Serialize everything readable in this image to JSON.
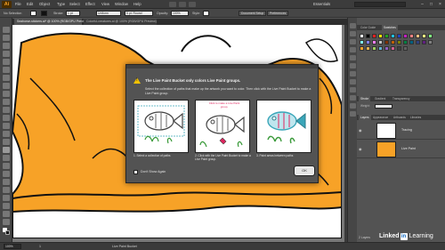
{
  "app": {
    "logo": "Ai"
  },
  "menubar": {
    "items": [
      "File",
      "Edit",
      "Object",
      "Type",
      "Select",
      "Effect",
      "View",
      "Window",
      "Help"
    ],
    "workspace": "Essentials"
  },
  "control_bar": {
    "selection": "No Selection",
    "stroke_label": "Stroke:",
    "stroke_value": "1 pt",
    "uniform": "Uniform",
    "brush": "5 pt. Round",
    "opacity_label": "Opacity:",
    "opacity_value": "100%",
    "style_label": "Style:",
    "doc_setup": "Document Setup",
    "preferences": "Preferences"
  },
  "tabs": [
    {
      "label": "Seahorse-stickers.ai* @ 100% (RGB/GPU Preview)"
    },
    {
      "label": "Colorful-creatures.ai @ 100% (RGB/GPU Preview)"
    }
  ],
  "status_bar": {
    "zoom": "100%",
    "artboard": "1",
    "tool": "Live Paint Bucket"
  },
  "panels": {
    "swatch_tabs": [
      "Color Guide",
      "Swatches"
    ],
    "stroke_tabs": [
      "Stroke",
      "Gradient",
      "Transparency"
    ],
    "weight_label": "Weight:",
    "layer_tabs": [
      "Layers",
      "Appearance",
      "Artboards",
      "Libraries"
    ],
    "layers": [
      {
        "name": "Tracing"
      },
      {
        "name": "Live Paint"
      }
    ],
    "layer_count": "2 Layers",
    "swatch_colors": [
      "#ffffff",
      "#000000",
      "#e02020",
      "#f0e000",
      "#20a020",
      "#20c0e0",
      "#2040c0",
      "#c020c0",
      "#ff8080",
      "#ffc080",
      "#ffff80",
      "#80ff80",
      "#80ffff",
      "#8080ff",
      "#ff80ff",
      "#c0c0c0",
      "#803000",
      "#c06000",
      "#808000",
      "#008040",
      "#006080",
      "#304080",
      "#602080",
      "#808080",
      "#f7a227",
      "#e0b050",
      "#a0d060",
      "#60b0d0",
      "#9060c0",
      "#d06090",
      "#404040",
      "#606060"
    ]
  },
  "dialog": {
    "title": "The Live Paint Bucket only colors Live Paint groups.",
    "body": "Select the collection of paths that make up the artwork you want to color. Then click with the Live Paint Bucket to make a Live Paint group.",
    "step2_hint": "Click to make a Live Paint group.",
    "steps": [
      {
        "caption": "1. Select a collection of paths"
      },
      {
        "caption": "2. Click with the Live Paint Bucket to make a Live Paint group."
      },
      {
        "caption": "3. Paint areas between paths"
      }
    ],
    "dont_show_label": "Don't Show Again",
    "ok_label": "OK"
  },
  "watermark": {
    "brand": "Linked",
    "badge": "in",
    "product": "Learning"
  },
  "colors": {
    "orange_fill": "#f7a227",
    "fish_teal": "#3aa6b9",
    "fish_gray": "#444444",
    "hint_pink": "#e0245e",
    "plant_green": "#3a9a3a"
  }
}
